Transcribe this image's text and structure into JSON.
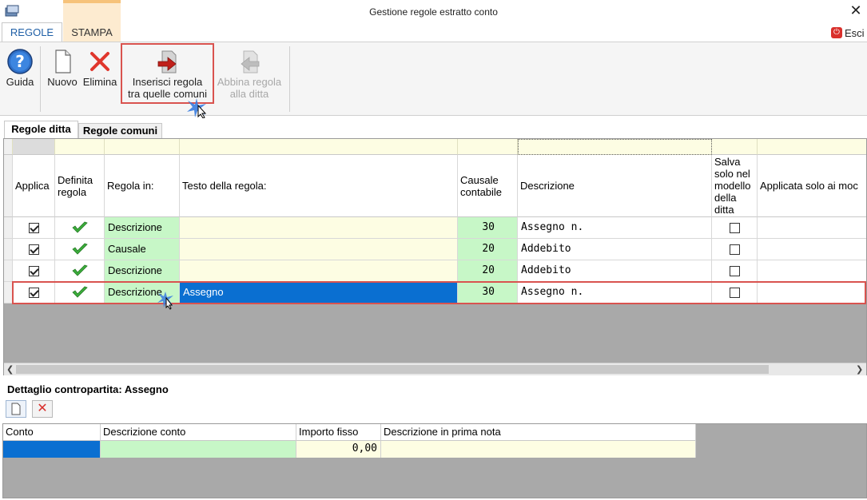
{
  "window": {
    "title": "Gestione regole estratto conto"
  },
  "ribbon_tabs": [
    {
      "label": "REGOLE"
    },
    {
      "label": "STAMPA"
    }
  ],
  "exit": {
    "label": "Esci"
  },
  "toolbar": {
    "guida": "Guida",
    "nuovo": "Nuovo",
    "elimina": "Elimina",
    "inserisci_line1": "Inserisci regola",
    "inserisci_line2": "tra quelle comuni",
    "abbina_line1": "Abbina regola",
    "abbina_line2": "alla ditta"
  },
  "inner_tabs": [
    {
      "label": "Regole ditta"
    },
    {
      "label": "Regole comuni"
    }
  ],
  "grid": {
    "columns": {
      "applica": "Applica",
      "definita1": "Definita",
      "definita2": "regola",
      "regola_in": "Regola in:",
      "testo": "Testo della regola:",
      "causale1": "Causale",
      "causale2": "contabile",
      "descrizione": "Descrizione",
      "salva1": "Salva",
      "salva2": "solo nel",
      "salva3": "modello",
      "salva4": "della",
      "salva5": "ditta",
      "applicata": "Applicata solo ai moc"
    },
    "rows": [
      {
        "applica": true,
        "definita": true,
        "regola_in": "Descrizione",
        "testo": "",
        "causale": "30",
        "descrizione": "Assegno n.",
        "salva": false
      },
      {
        "applica": true,
        "definita": true,
        "regola_in": "Causale",
        "testo": "",
        "causale": "20",
        "descrizione": "Addebito",
        "salva": false
      },
      {
        "applica": true,
        "definita": true,
        "regola_in": "Descrizione",
        "testo": "",
        "causale": "20",
        "descrizione": "Addebito",
        "salva": false
      },
      {
        "applica": true,
        "definita": true,
        "regola_in": "Descrizione",
        "testo": "Assegno",
        "causale": "30",
        "descrizione": "Assegno n.",
        "salva": false,
        "selected": true
      }
    ]
  },
  "detail": {
    "title": "Dettaglio contropartita: Assegno",
    "columns": {
      "conto": "Conto",
      "descrizione_conto": "Descrizione conto",
      "importo_fisso": "Importo fisso",
      "descrizione_prima_nota": "Descrizione in prima nota"
    },
    "row": {
      "conto": "",
      "descrizione_conto": "",
      "importo_fisso": "0,00",
      "descrizione_prima_nota": ""
    }
  },
  "colors": {
    "accent_tab": "#1f5fa6",
    "highlight_red": "#d9534f",
    "selection_blue": "#0a6fd1",
    "green_cell": "#c7f7c7",
    "yellow_cell": "#fdfde3"
  }
}
